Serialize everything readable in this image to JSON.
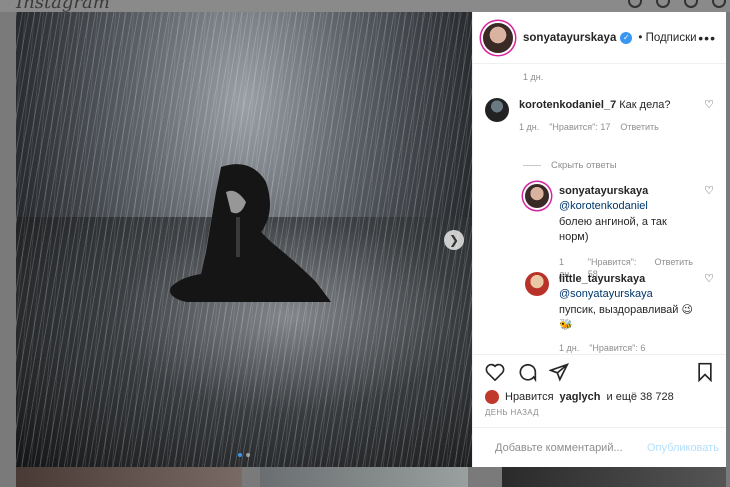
{
  "page": {
    "logo": "Instagram"
  },
  "post": {
    "username": "sonyatayurskaya",
    "verified_mark": "✓",
    "follow_label": "• Подписки",
    "more_label": "•••",
    "next_icon": "chevron-right-icon",
    "carousel": {
      "count": 2,
      "active": 0
    }
  },
  "comments": {
    "top_time": "1 дн.",
    "main": {
      "user": "korotenkodaniel_7",
      "text": "Как дела?",
      "time": "1 дн.",
      "likes": "\"Нравится\": 17",
      "reply_label": "Ответить"
    },
    "hide_replies": "Скрыть ответы",
    "replies": [
      {
        "user": "sonyatayurskaya",
        "mention": "@korotenkodaniel",
        "text": "болею ангиной, а так норм)",
        "time": "1 дн.",
        "likes": "\"Нравится\": 58",
        "reply_label": "Ответить"
      },
      {
        "user": "little_tayurskaya",
        "mention": "@sonyatayurskaya",
        "text": "пупсик, выздоравливай 😉🐝",
        "time": "1 дн.",
        "likes": "\"Нравится\": 6"
      }
    ]
  },
  "actions": {
    "like_icon": "heart-icon",
    "comment_icon": "comment-icon",
    "share_icon": "send-icon",
    "save_icon": "bookmark-icon"
  },
  "likes": {
    "prefix": "Нравится",
    "user": "yaglych",
    "suffix": "и ещё 38 728"
  },
  "date": "ДЕНЬ НАЗАД",
  "composer": {
    "placeholder": "Добавьте комментарий...",
    "publish_label": "Опубликовать",
    "emoji_icon": "smile-icon"
  },
  "colors": {
    "accent": "#3897f0",
    "publish_disabled": "#b2dffc",
    "mention": "#00376b"
  }
}
